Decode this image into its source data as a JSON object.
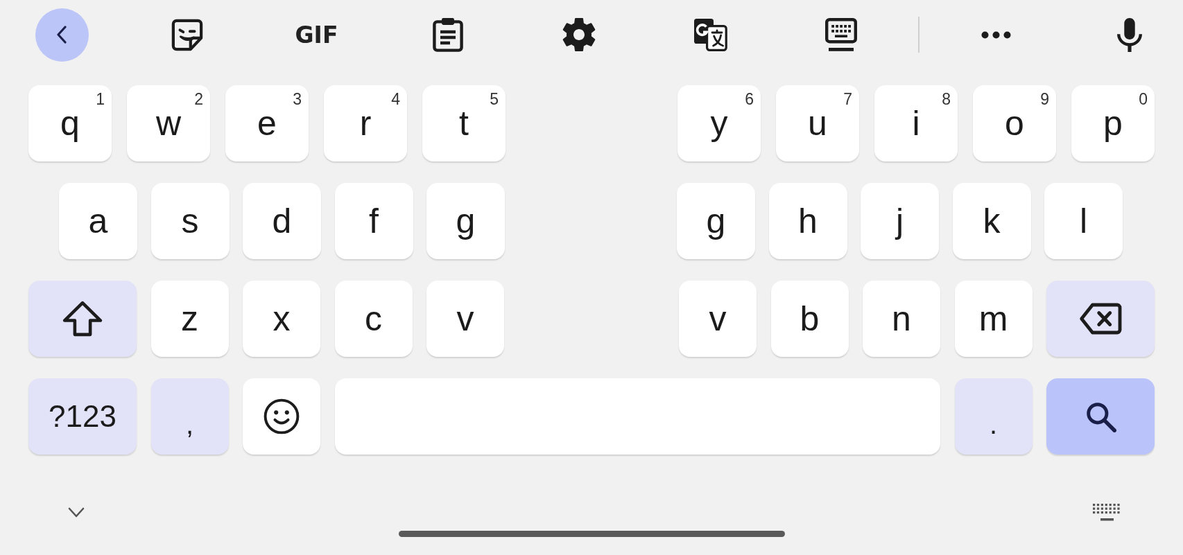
{
  "toolbar": [
    {
      "kind": "back"
    },
    {
      "kind": "sticker"
    },
    {
      "kind": "gif",
      "label": "GIF"
    },
    {
      "kind": "clipboard"
    },
    {
      "kind": "settings"
    },
    {
      "kind": "translate"
    },
    {
      "kind": "keyboard"
    },
    {
      "kind": "divider"
    },
    {
      "kind": "more"
    },
    {
      "kind": "mic"
    }
  ],
  "rows": [
    {
      "left": [
        {
          "kind": "letter",
          "label": "q",
          "hint": "1"
        },
        {
          "kind": "letter",
          "label": "w",
          "hint": "2"
        },
        {
          "kind": "letter",
          "label": "e",
          "hint": "3"
        },
        {
          "kind": "letter",
          "label": "r",
          "hint": "4"
        },
        {
          "kind": "letter",
          "label": "t",
          "hint": "5"
        }
      ],
      "right": [
        {
          "kind": "letter",
          "label": "y",
          "hint": "6"
        },
        {
          "kind": "letter",
          "label": "u",
          "hint": "7"
        },
        {
          "kind": "letter",
          "label": "i",
          "hint": "8"
        },
        {
          "kind": "letter",
          "label": "o",
          "hint": "9"
        },
        {
          "kind": "letter",
          "label": "p",
          "hint": "0"
        }
      ]
    },
    {
      "left": [
        {
          "kind": "letter",
          "label": "a"
        },
        {
          "kind": "letter",
          "label": "s"
        },
        {
          "kind": "letter",
          "label": "d"
        },
        {
          "kind": "letter",
          "label": "f"
        },
        {
          "kind": "letter",
          "label": "g"
        }
      ],
      "right": [
        {
          "kind": "letter",
          "label": "g"
        },
        {
          "kind": "letter",
          "label": "h"
        },
        {
          "kind": "letter",
          "label": "j"
        },
        {
          "kind": "letter",
          "label": "k"
        },
        {
          "kind": "letter",
          "label": "l"
        }
      ]
    },
    {
      "left": [
        {
          "kind": "shift"
        },
        {
          "kind": "letter",
          "label": "z"
        },
        {
          "kind": "letter",
          "label": "x"
        },
        {
          "kind": "letter",
          "label": "c"
        },
        {
          "kind": "letter",
          "label": "v"
        }
      ],
      "right": [
        {
          "kind": "letter",
          "label": "v"
        },
        {
          "kind": "letter",
          "label": "b"
        },
        {
          "kind": "letter",
          "label": "n"
        },
        {
          "kind": "letter",
          "label": "m"
        },
        {
          "kind": "backspace"
        }
      ]
    }
  ],
  "bottom_row": [
    {
      "kind": "symbols",
      "label": "?123"
    },
    {
      "kind": "punct",
      "label": ","
    },
    {
      "kind": "emoji"
    },
    {
      "kind": "space"
    },
    {
      "kind": "punct",
      "label": "."
    },
    {
      "kind": "search"
    }
  ]
}
